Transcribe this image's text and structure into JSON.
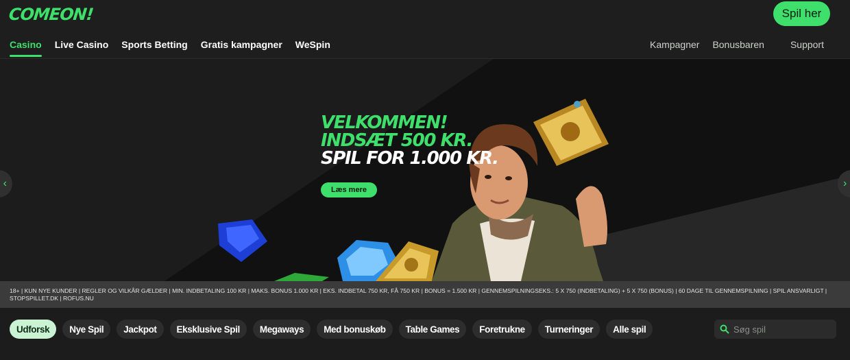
{
  "brand": {
    "logo_text": "COMEON!",
    "accent": "#3ee06b"
  },
  "header": {
    "cta_label": "Spil her"
  },
  "nav": {
    "left": [
      "Casino",
      "Live Casino",
      "Sports Betting",
      "Gratis kampagner",
      "WeSpin"
    ],
    "right": [
      "Kampagner",
      "Bonusbaren",
      "Support"
    ],
    "active": "Casino"
  },
  "hero": {
    "line1": "VELKOMMEN!",
    "line2": "INDSÆT 500 KR.",
    "line3": "SPIL FOR 1.000 KR.",
    "button_label": "Læs mere",
    "prev_icon": "‹",
    "next_icon": "›"
  },
  "disclaimer": "18+ | KUN NYE KUNDER | REGLER OG VILKÅR GÆLDER | MIN. INDBETALING 100 KR | MAKS. BONUS 1.000 KR | EKS. INDBETAL 750 KR, FÅ 750 KR | BONUS = 1.500 KR | GENNEMSPILNINGSEKS.: 5 X 750 (INDBETALING) + 5 X 750 (BONUS) | 60 DAGE TIL GENNEMSPILNING | SPIL ANSVARLIGT | STOPSPILLET.DK | ROFUS.NU",
  "categories": {
    "chips": [
      "Udforsk",
      "Nye Spil",
      "Jackpot",
      "Eksklusive Spil",
      "Megaways",
      "Med bonuskøb",
      "Table Games",
      "Foretrukne",
      "Turneringer",
      "Alle spil"
    ],
    "active": "Udforsk"
  },
  "search": {
    "placeholder": "Søg spil"
  }
}
